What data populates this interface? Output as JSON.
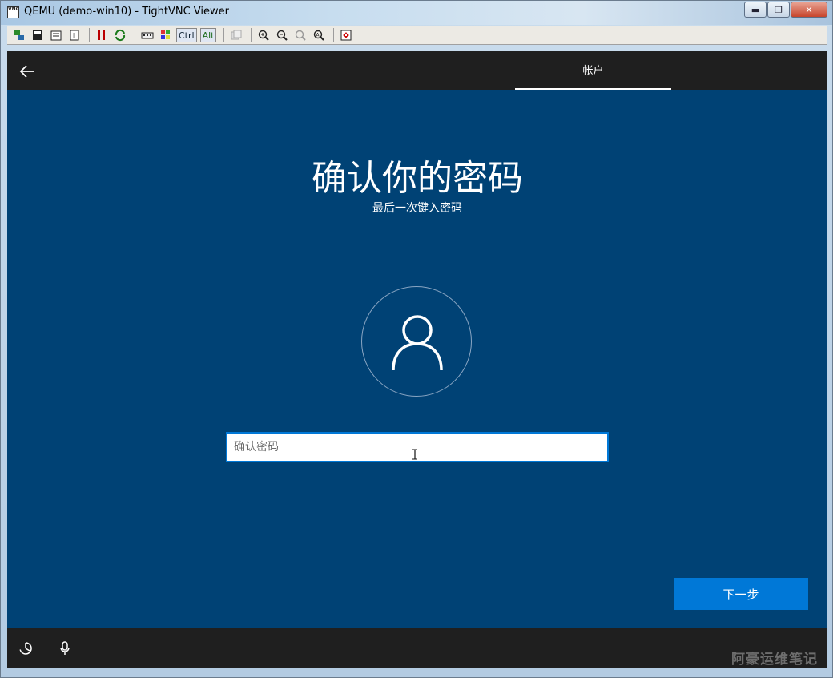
{
  "window": {
    "title": "QEMU (demo-win10) - TightVNC Viewer",
    "app_icon_text": "VNC",
    "min_glyph": "▬",
    "max_glyph": "❐",
    "close_glyph": "✕"
  },
  "toolbar": {
    "ctrl_label": "Ctrl",
    "alt_label": "Alt"
  },
  "setup": {
    "tab_label": "帐户",
    "heading": "确认你的密码",
    "subheading": "最后一次键入密码",
    "password_placeholder": "确认密码",
    "next_label": "下一步"
  },
  "watermark": "阿豪运维笔记",
  "colors": {
    "background": "#004275",
    "bar": "#1f1f1f",
    "accent": "#0078d7"
  }
}
